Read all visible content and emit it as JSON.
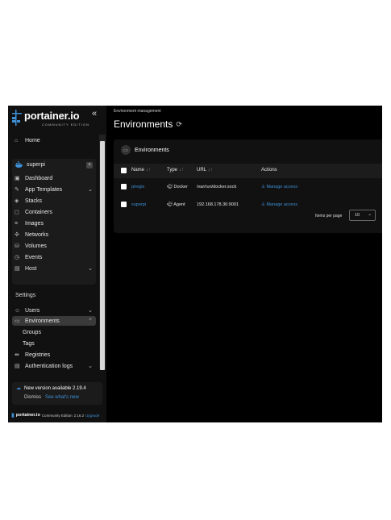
{
  "brand": {
    "name": "portainer.io",
    "edition": "COMMUNITY EDITION"
  },
  "sidebar": {
    "home": "Home",
    "environment": "superpi",
    "env_items": [
      "Dashboard",
      "App Templates",
      "Stacks",
      "Containers",
      "Images",
      "Networks",
      "Volumes",
      "Events",
      "Host"
    ],
    "settings_title": "Settings",
    "settings_items": [
      "Users",
      "Environments",
      "Groups",
      "Tags",
      "Registries",
      "Authentication logs"
    ],
    "update": {
      "title": "New version available 2.19.4",
      "dismiss": "Dismiss",
      "whats_new": "See what's new"
    },
    "footer": {
      "brand": "portainer.io",
      "edition": "Community Edition",
      "version": "2.16.2",
      "upgrade": "Upgrade"
    }
  },
  "main": {
    "breadcrumb": "Environment management",
    "title": "Environments",
    "panel_title": "Environments",
    "columns": [
      "Name",
      "Type",
      "URL",
      "Actions"
    ],
    "rows": [
      {
        "name": "piregis",
        "type": "Docker",
        "url": "/var/run/docker.sock",
        "action": "Manage access"
      },
      {
        "name": "superpi",
        "type": "Agent",
        "url": "192.168.178.36:9001",
        "action": "Manage access"
      }
    ],
    "items_per_page_label": "Items per page",
    "items_per_page": "10"
  },
  "colors": {
    "link": "#3d8fd6",
    "bg": "#000000",
    "panel": "#111111"
  }
}
